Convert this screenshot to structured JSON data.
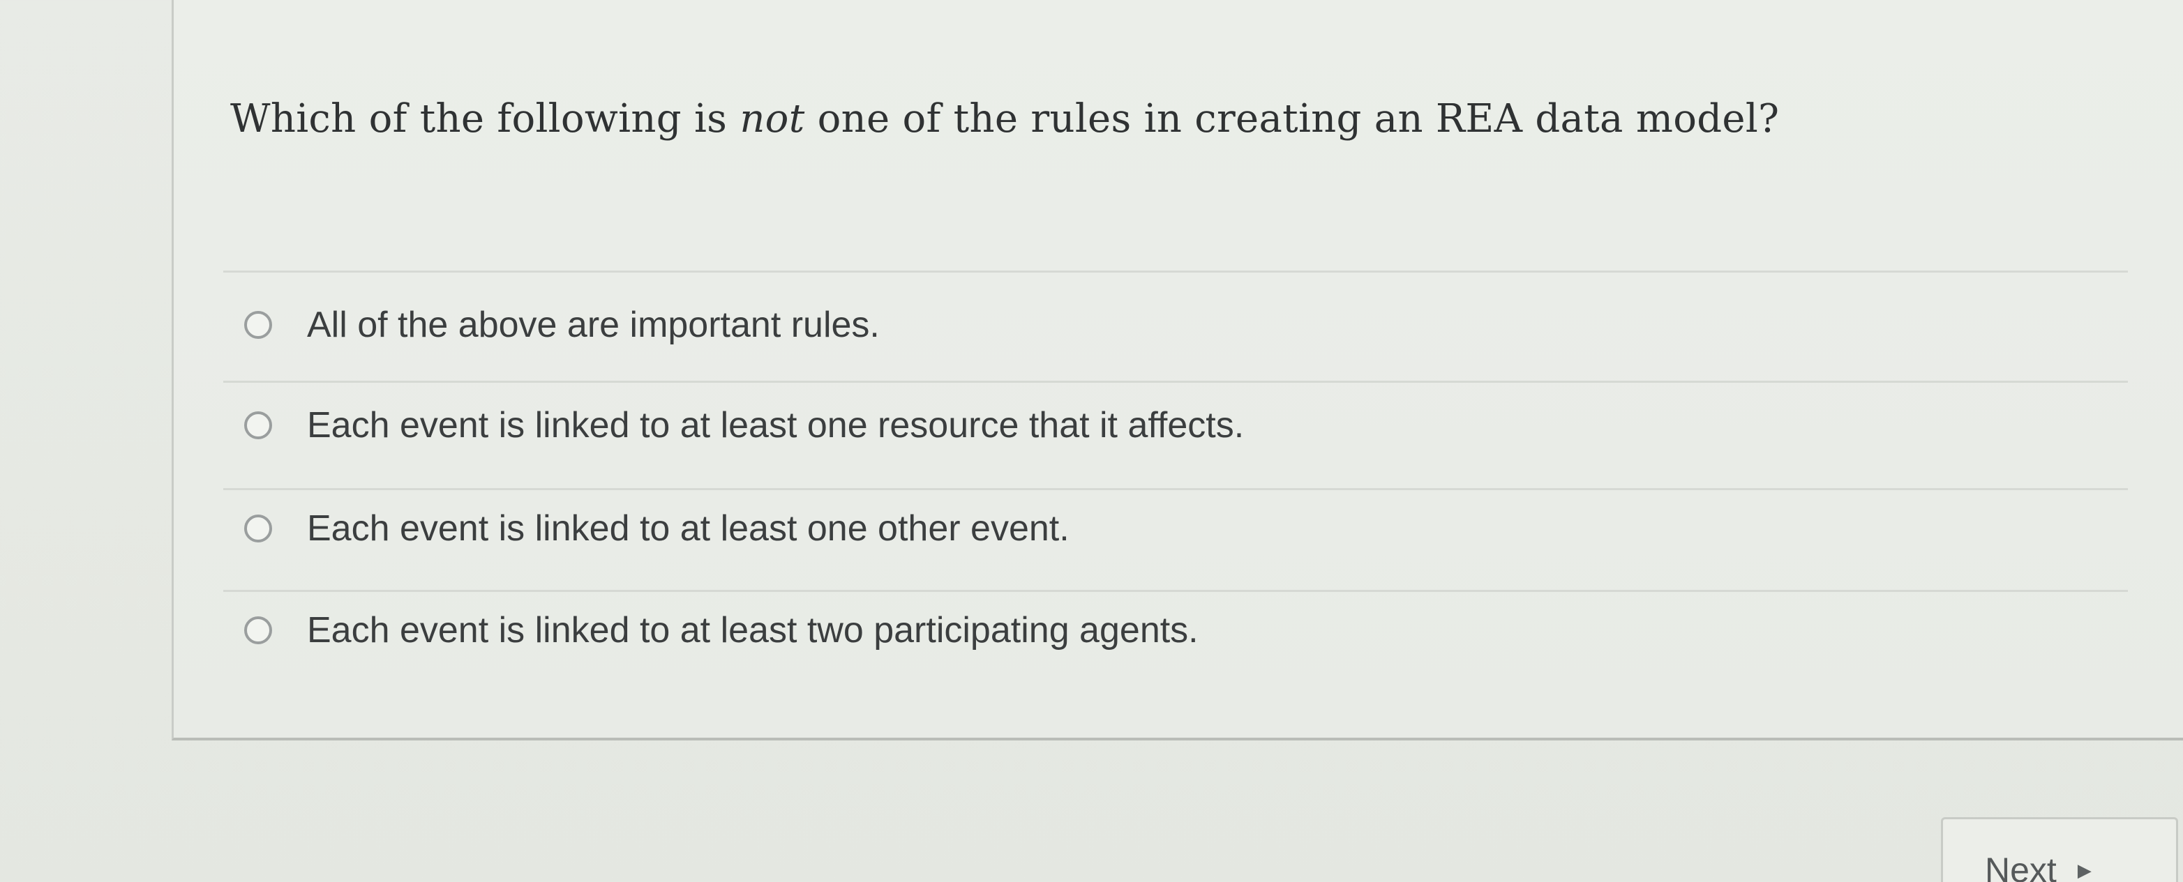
{
  "question": {
    "text_before": "Which of the following is ",
    "text_emphasis": "not",
    "text_after": " one of the rules in creating an REA data model?"
  },
  "options": [
    {
      "label": "All of the above are important rules."
    },
    {
      "label": "Each event is linked to at least one resource that it affects."
    },
    {
      "label": "Each event is linked to at least one other event."
    },
    {
      "label": "Each event is linked to at least two participating agents."
    }
  ],
  "navigation": {
    "next_label": "Next",
    "next_icon": "triangle-right-icon"
  }
}
